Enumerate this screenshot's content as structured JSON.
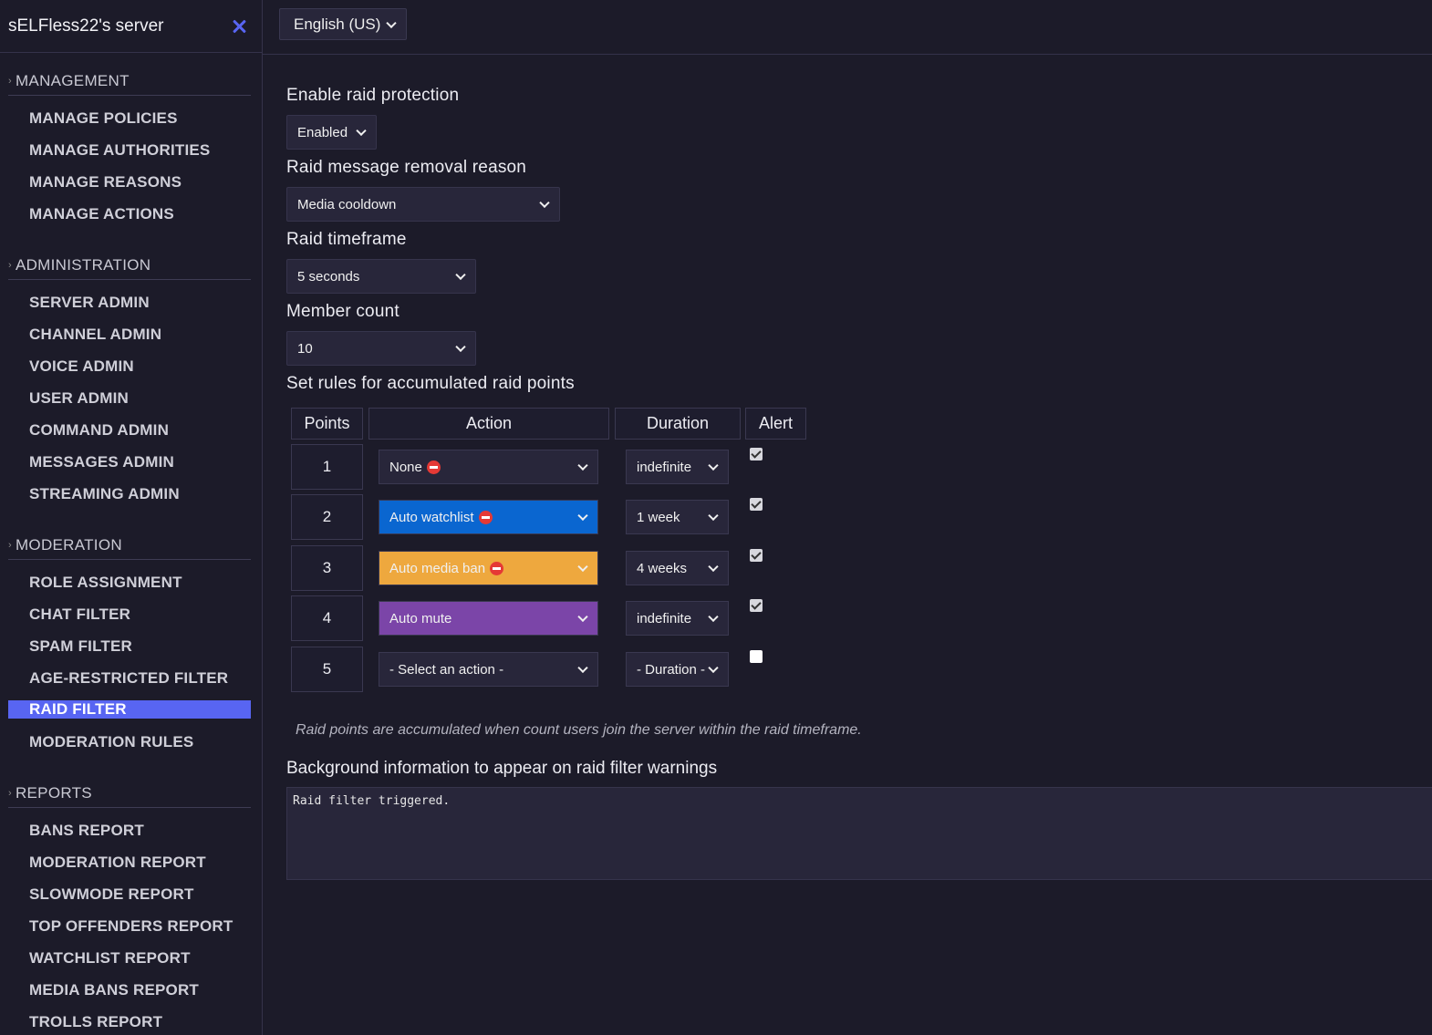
{
  "sidebar": {
    "server_name": "sELFless22's server",
    "sections": [
      {
        "title": "MANAGEMENT",
        "items": [
          "MANAGE POLICIES",
          "MANAGE AUTHORITIES",
          "MANAGE REASONS",
          "MANAGE ACTIONS"
        ]
      },
      {
        "title": "ADMINISTRATION",
        "items": [
          "SERVER ADMIN",
          "CHANNEL ADMIN",
          "VOICE ADMIN",
          "USER ADMIN",
          "COMMAND ADMIN",
          "MESSAGES ADMIN",
          "STREAMING ADMIN"
        ]
      },
      {
        "title": "MODERATION",
        "items": [
          "ROLE ASSIGNMENT",
          "CHAT FILTER",
          "SPAM FILTER",
          "AGE-RESTRICTED FILTER",
          "RAID FILTER",
          "MODERATION RULES"
        ]
      },
      {
        "title": "REPORTS",
        "items": [
          "BANS REPORT",
          "MODERATION REPORT",
          "SLOWMODE REPORT",
          "TOP OFFENDERS REPORT",
          "WATCHLIST REPORT",
          "MEDIA BANS REPORT",
          "TROLLS REPORT"
        ]
      }
    ],
    "active_item": "RAID FILTER"
  },
  "topbar": {
    "language": "English (US)"
  },
  "form": {
    "enable_label": "Enable raid protection",
    "enable_value": "Enabled",
    "reason_label": "Raid message removal reason",
    "reason_value": "Media cooldown",
    "timeframe_label": "Raid timeframe",
    "timeframe_value": "5 seconds",
    "member_label": "Member count",
    "member_value": "10",
    "rules_label": "Set rules for accumulated raid points"
  },
  "table": {
    "headers": {
      "points": "Points",
      "action": "Action",
      "duration": "Duration",
      "alert": "Alert"
    },
    "rows": [
      {
        "points": "1",
        "action": "None",
        "duration": "indefinite",
        "alert": true,
        "action_color": "#28263a",
        "stop": true
      },
      {
        "points": "2",
        "action": "Auto watchlist",
        "duration": "1 week",
        "alert": true,
        "action_color": "#0a66d0",
        "stop": true
      },
      {
        "points": "3",
        "action": "Auto media ban",
        "duration": "4 weeks",
        "alert": true,
        "action_color": "#eea83e",
        "stop": true
      },
      {
        "points": "4",
        "action": "Auto mute",
        "duration": "indefinite",
        "alert": true,
        "action_color": "#7b45a8",
        "stop": false
      },
      {
        "points": "5",
        "action": "- Select an action -",
        "duration": "- Duration -",
        "alert": false,
        "action_color": "#28263a",
        "stop": false
      }
    ]
  },
  "hint": "Raid points are accumulated when count users join the server within the raid timeframe.",
  "background": {
    "label": "Background information to appear on raid filter warnings",
    "value": "Raid filter triggered."
  },
  "colors": {
    "accent": "#5865f2",
    "background": "#1c1b29",
    "panel": "#28263a"
  }
}
